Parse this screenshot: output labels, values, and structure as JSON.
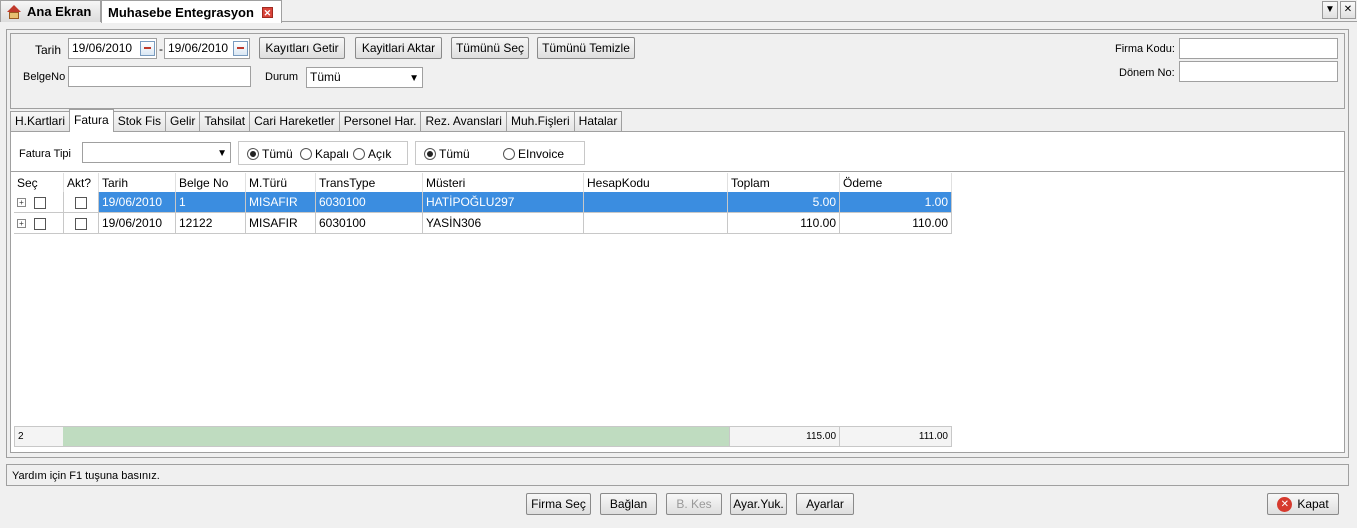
{
  "top_tabs": {
    "home": "Ana Ekran",
    "active": "Muhasebe Entegrasyon"
  },
  "filter": {
    "tarih_label": "Tarih",
    "date_from": "19/06/2010",
    "date_sep": "-",
    "date_to": "19/06/2010",
    "belgeno_label": "BelgeNo",
    "belgeno_value": "",
    "durum_label": "Durum",
    "durum_value": "Tümü",
    "firma_kodu_label": "Firma Kodu:",
    "firma_kodu_value": "",
    "donem_no_label": "Dönem No:",
    "donem_no_value": "",
    "buttons": {
      "kayitlari_getir": "Kayıtları Getir",
      "kayitlari_aktar": "Kayitlari Aktar",
      "tumunu_sec": "Tümünü Seç",
      "tumunu_temizle": "Tümünü Temizle"
    }
  },
  "tabs": [
    "H.Kartlari",
    "Fatura",
    "Stok Fis",
    "Gelir",
    "Tahsilat",
    "Cari Hareketler",
    "Personel Har.",
    "Rez. Avanslari",
    "Muh.Fişleri",
    "Hatalar"
  ],
  "active_tab": "Fatura",
  "fatura": {
    "fatura_tipi_label": "Fatura Tipi",
    "fatura_tipi_value": "",
    "radio1": {
      "tumu": "Tümü",
      "kapali": "Kapalı",
      "acik": "Açık",
      "selected": "tumu"
    },
    "radio2": {
      "tumu": "Tümü",
      "einvoice": "EInvoice",
      "selected": "tumu"
    }
  },
  "grid": {
    "columns": [
      "Seç",
      "Akt?",
      "Tarih",
      "Belge No",
      "M.Türü",
      "TransType",
      "Müsteri",
      "HesapKodu",
      "Toplam",
      "Ödeme"
    ],
    "rows": [
      {
        "tarih": "19/06/2010",
        "belge_no": "1",
        "m_turu": "MISAFIR",
        "trans_type": "6030100",
        "musteri": "HATİPOĞLU297",
        "hesap_kodu": "",
        "toplam": "5.00",
        "odeme": "1.00",
        "selected": true
      },
      {
        "tarih": "19/06/2010",
        "belge_no": "12122",
        "m_turu": "MISAFIR",
        "trans_type": "6030100",
        "musteri": "YASİN306",
        "hesap_kodu": "",
        "toplam": "110.00",
        "odeme": "110.00",
        "selected": false
      }
    ],
    "footer": {
      "count": "2",
      "toplam": "115.00",
      "odeme": "111.00"
    }
  },
  "status_text": "Yardım için F1 tuşuna basınız.",
  "bottom_buttons": {
    "firma_sec": "Firma Seç",
    "baglan": "Bağlan",
    "b_kes": "B. Kes",
    "ayar_yuk": "Ayar.Yuk.",
    "ayarlar": "Ayarlar",
    "kapat": "Kapat"
  }
}
